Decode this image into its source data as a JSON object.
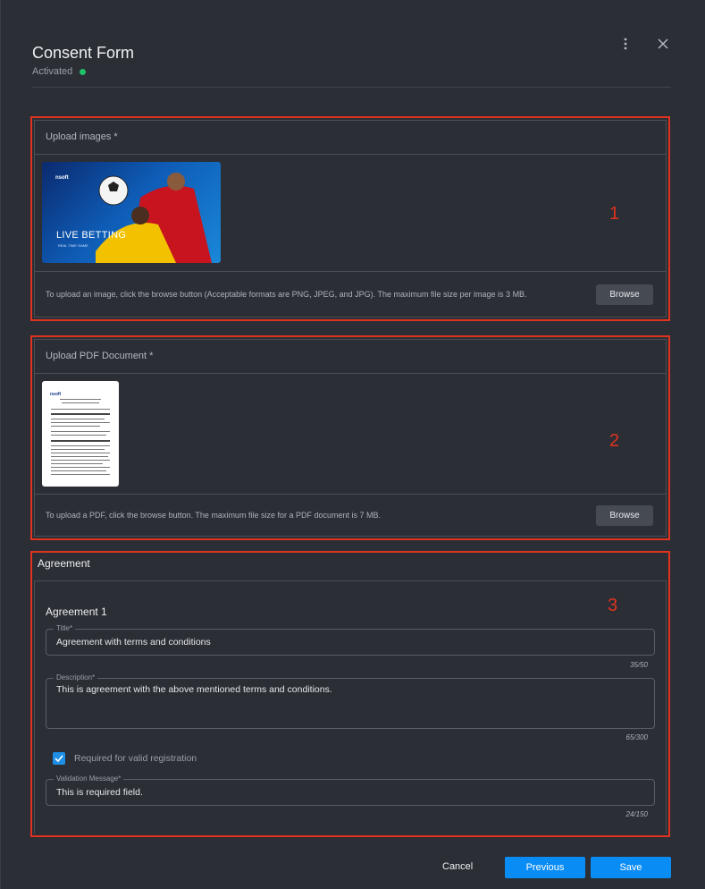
{
  "header": {
    "title": "Consent Form",
    "status": "Activated",
    "status_color": "#1fc06a",
    "more_icon": "more-vertical-icon",
    "close_icon": "close-icon"
  },
  "images_section": {
    "header": "Upload images *",
    "banner_text": "LIVE BETTING",
    "banner_sub": "REAL TIME GAME",
    "banner_logo": "nsoft",
    "helper": "To upload an image, click the browse button (Acceptable formats are PNG, JPEG, and JPG). The maximum file size per image is 3 MB.",
    "browse_label": "Browse",
    "marker": "1"
  },
  "pdf_section": {
    "header": "Upload PDF Document *",
    "pdf_logo": "nsoft",
    "helper": "To upload a PDF, click the browse button. The maximum file size for a PDF document is 7 MB.",
    "browse_label": "Browse",
    "marker": "2"
  },
  "agreement_section": {
    "title": "Agreement",
    "subtitle": "Agreement 1",
    "marker": "3",
    "title_field": {
      "label": "Title*",
      "value": "Agreement with terms and conditions",
      "counter": "35/50"
    },
    "description_field": {
      "label": "Description*",
      "value": "This is agreement with the above mentioned terms and conditions.",
      "counter": "65/300"
    },
    "checkbox": {
      "label": "Required for valid registration",
      "checked": true
    },
    "validation_field": {
      "label": "Validation Message*",
      "value": "This is required field.",
      "counter": "24/150"
    }
  },
  "actions": {
    "cancel": "Cancel",
    "previous": "Previous",
    "save": "Save"
  },
  "colors": {
    "accent": "#0a8cf5",
    "highlight": "#e0331f"
  }
}
